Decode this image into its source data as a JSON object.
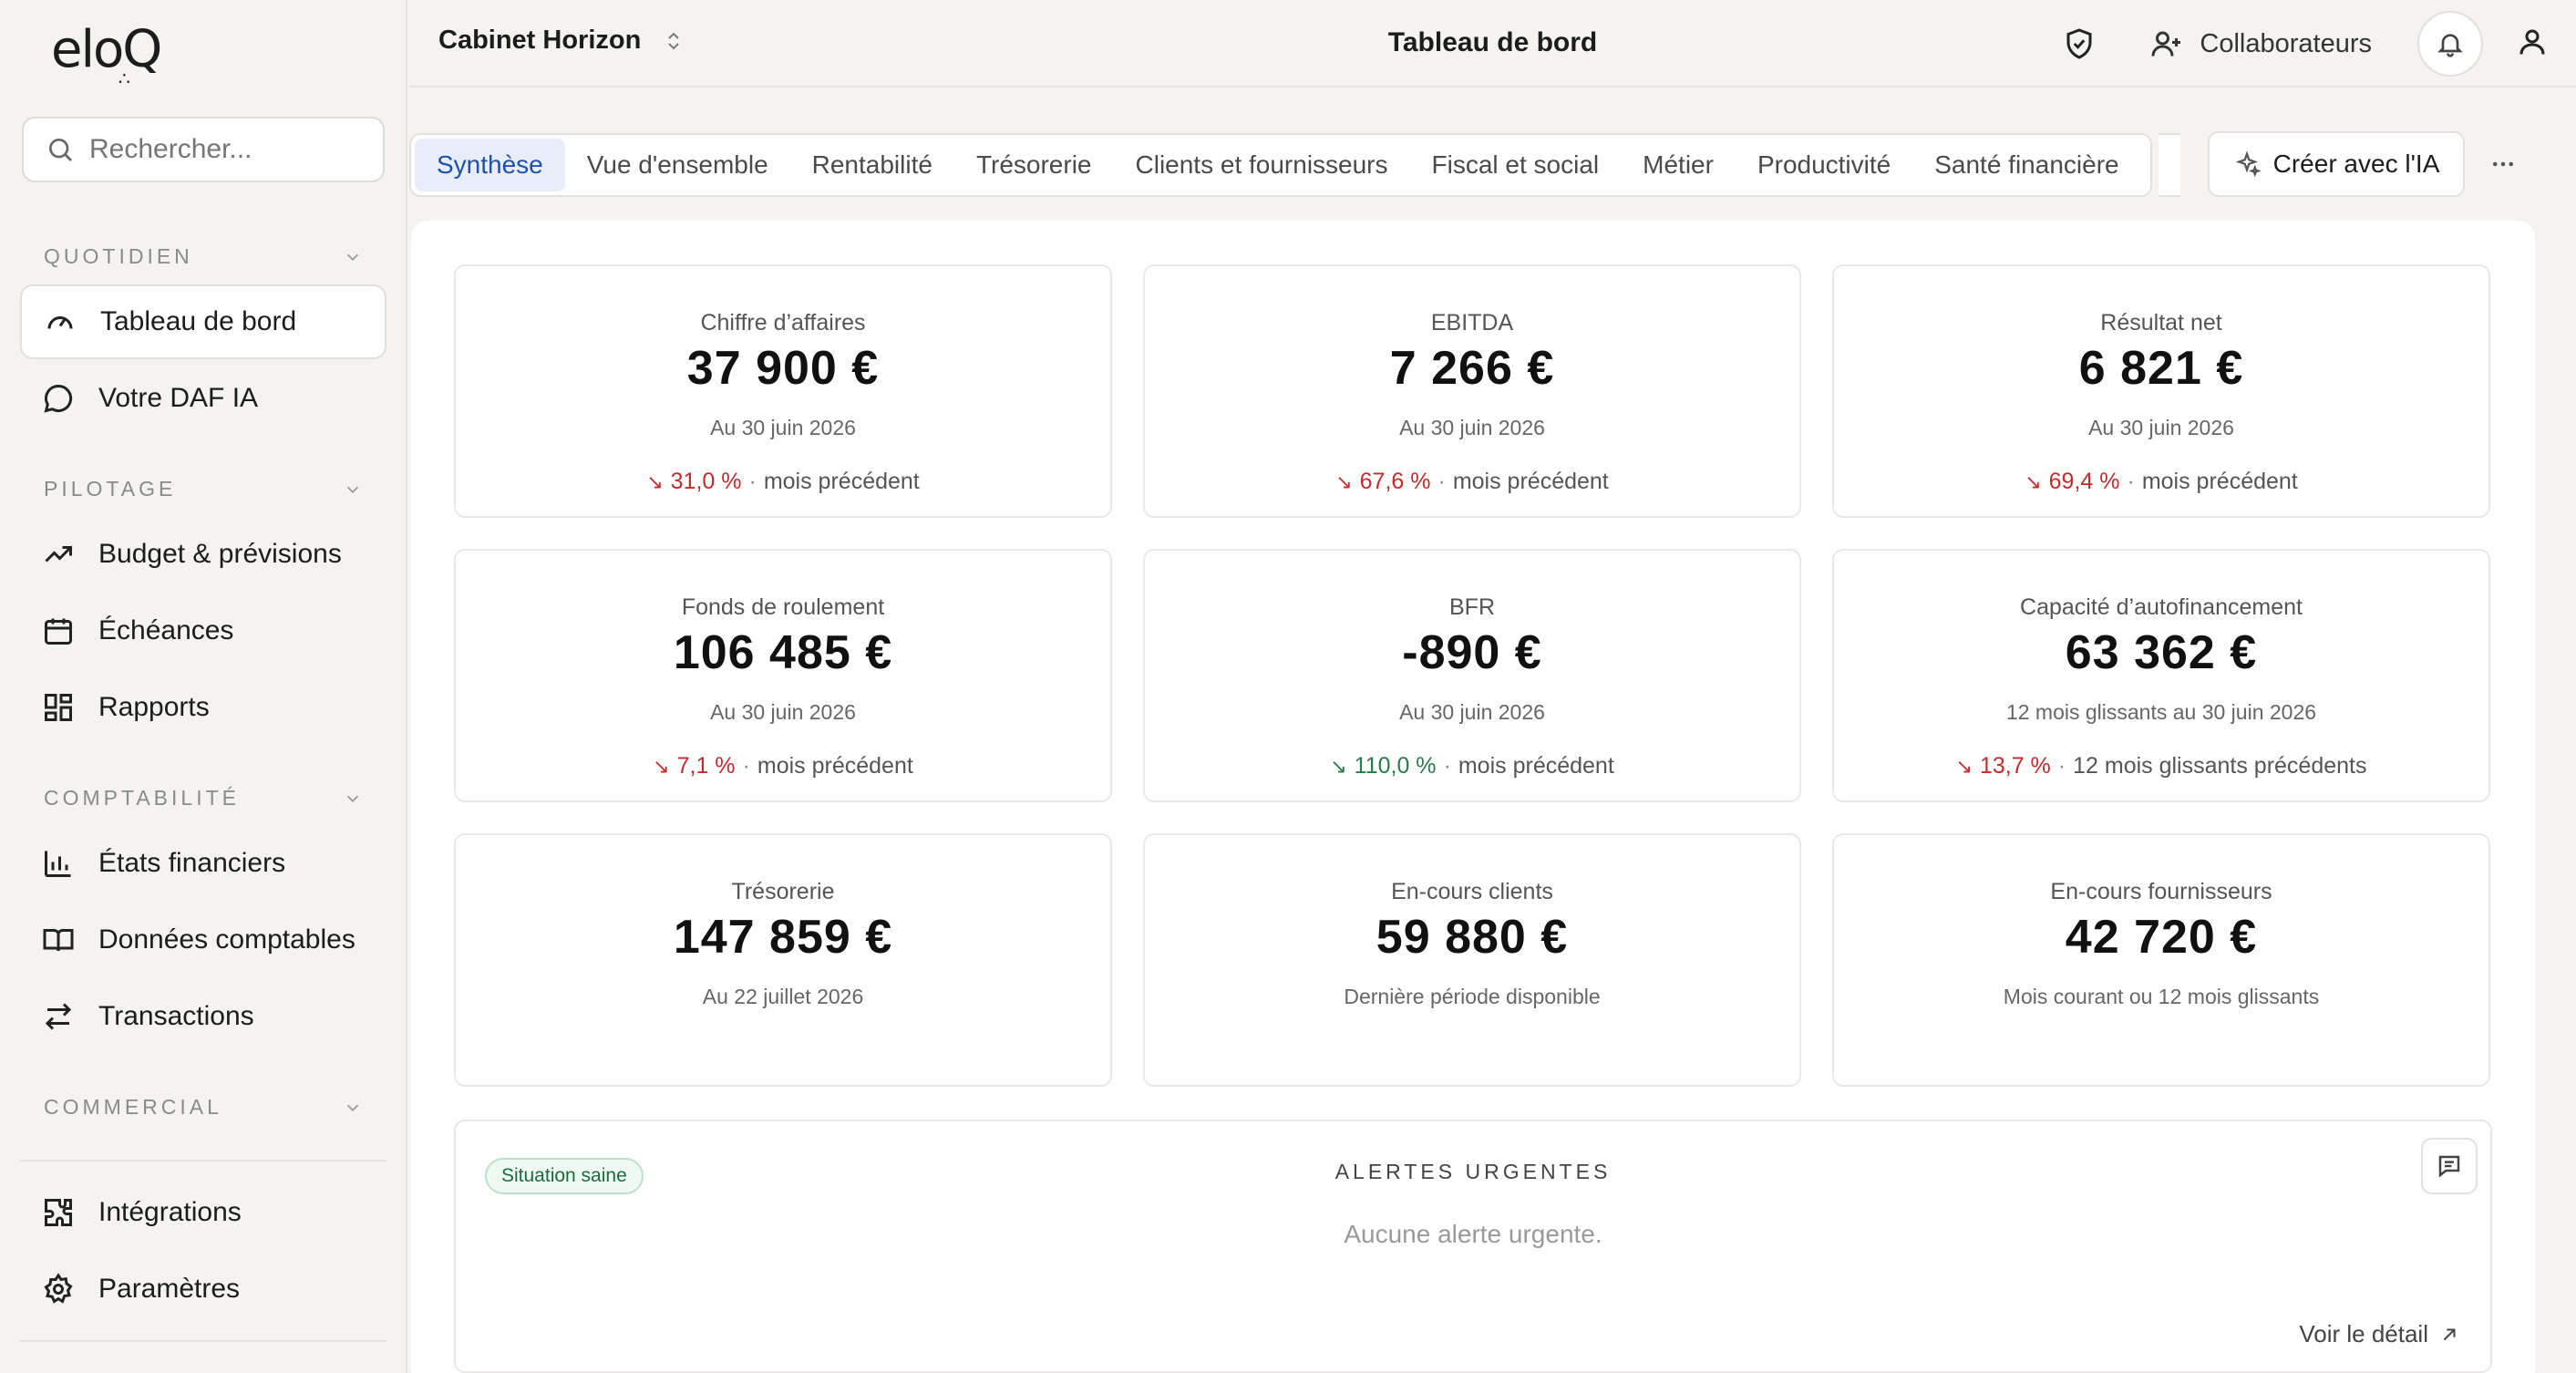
{
  "brand": {
    "logo": "eloQ"
  },
  "search": {
    "placeholder": "Rechercher..."
  },
  "sidebar": {
    "sections": [
      {
        "label": "QUOTIDIEN"
      },
      {
        "label": "PILOTAGE"
      },
      {
        "label": "COMPTABILITÉ"
      },
      {
        "label": "COMMERCIAL"
      }
    ],
    "items": {
      "dashboard": "Tableau de bord",
      "daf": "Votre DAF IA",
      "budget": "Budget & prévisions",
      "echeances": "Échéances",
      "rapports": "Rapports",
      "etats": "États financiers",
      "donnees": "Données comptables",
      "transactions": "Transactions",
      "integrations": "Intégrations",
      "parametres": "Paramètres"
    }
  },
  "header": {
    "org": "Cabinet Horizon",
    "title": "Tableau de bord",
    "collaborators": "Collaborateurs"
  },
  "tabs": [
    {
      "label": "Synthèse",
      "active": true
    },
    {
      "label": "Vue d'ensemble"
    },
    {
      "label": "Rentabilité"
    },
    {
      "label": "Trésorerie"
    },
    {
      "label": "Clients et fournisseurs"
    },
    {
      "label": "Fiscal et social"
    },
    {
      "label": "Métier"
    },
    {
      "label": "Productivité"
    },
    {
      "label": "Santé financière"
    }
  ],
  "ai_button": "Créer avec l'IA",
  "kpis": {
    "ca": {
      "label": "Chiffre d’affaires",
      "value": "37 900 €",
      "sub": "Au 30 juin 2026",
      "pct": "31,0 %",
      "compare": "mois précédent"
    },
    "ebitda": {
      "label": "EBITDA",
      "value": "7 266 €",
      "sub": "Au 30 juin 2026",
      "pct": "67,6 %",
      "compare": "mois précédent"
    },
    "resultat": {
      "label": "Résultat net",
      "value": "6 821 €",
      "sub": "Au 30 juin 2026",
      "pct": "69,4 %",
      "compare": "mois précédent"
    },
    "fonds": {
      "label": "Fonds de roulement",
      "value": "106 485 €",
      "sub": "Au 30 juin 2026",
      "pct": "7,1 %",
      "compare": "mois précédent"
    },
    "bfr": {
      "label": "BFR",
      "value": "-890 €",
      "sub": "Au 30 juin 2026",
      "pct": "110,0 %",
      "compare": "mois précédent"
    },
    "caf": {
      "label": "Capacité d’autofinancement",
      "value": "63 362 €",
      "sub": "12 mois glissants au 30 juin 2026",
      "pct": "13,7 %",
      "compare": "12 mois glissants précédents"
    },
    "tresorerie": {
      "label": "Trésorerie",
      "value": "147 859 €",
      "sub": "Au 22 juillet 2026"
    },
    "clients": {
      "label": "En-cours clients",
      "value": "59 880 €",
      "sub": "Dernière période disponible"
    },
    "fournisseurs": {
      "label": "En-cours fournisseurs",
      "value": "42 720 €",
      "sub": "Mois courant ou 12 mois glissants"
    }
  },
  "colors": {
    "down_red": "#c42b2b",
    "down_green": "#2a7a4a",
    "active_tab": "#1f4fb0"
  },
  "alerts": {
    "badge": "Situation saine",
    "title": "ALERTES URGENTES",
    "empty": "Aucune alerte urgente.",
    "detail_link": "Voir le détail"
  }
}
